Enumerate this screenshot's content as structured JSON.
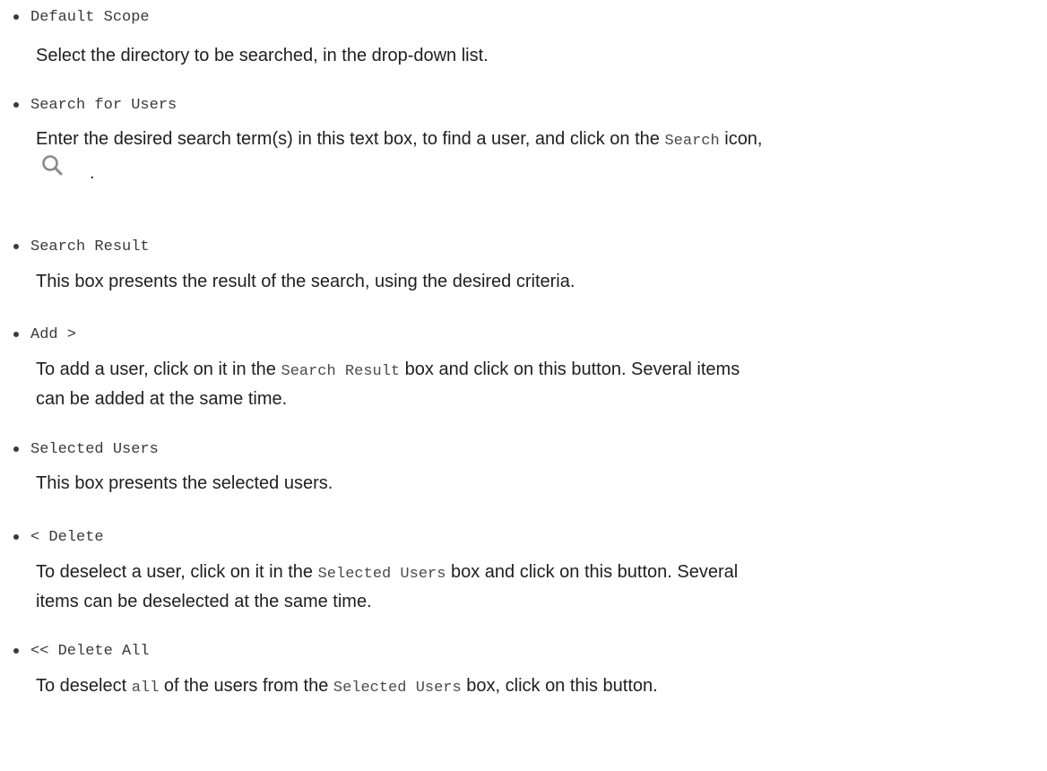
{
  "items": [
    {
      "term": "Default Scope",
      "desc": "Select the directory to be searched, in the drop-down list."
    },
    {
      "term": "Search for Users",
      "desc_pre": "Enter the desired search term(s) in this text box, to find a user, and click on the ",
      "desc_code": "Search",
      "desc_post": " icon,",
      "icon_trail": "."
    },
    {
      "term": "Search Result",
      "desc": "This box presents the result of the search, using the desired criteria."
    },
    {
      "term": "Add >",
      "desc_pre": "To add a user, click on it in the ",
      "desc_code": "Search Result",
      "desc_post": " box and click on this button. Several items",
      "desc_line2": "can be added at the same time."
    },
    {
      "term": "Selected Users",
      "desc": "This box presents the selected users."
    },
    {
      "term": "< Delete",
      "desc_pre": "To deselect a user, click on it in the ",
      "desc_code": "Selected Users",
      "desc_post": " box and click on this button. Several",
      "desc_line2": "items can be deselected at the same time."
    },
    {
      "term": "<< Delete All",
      "desc_pre": "To deselect ",
      "desc_code": "all",
      "desc_mid": " of the users from the ",
      "desc_code2": "Selected Users",
      "desc_post": " box, click on this button."
    }
  ],
  "icons": {
    "search": "search-icon"
  }
}
